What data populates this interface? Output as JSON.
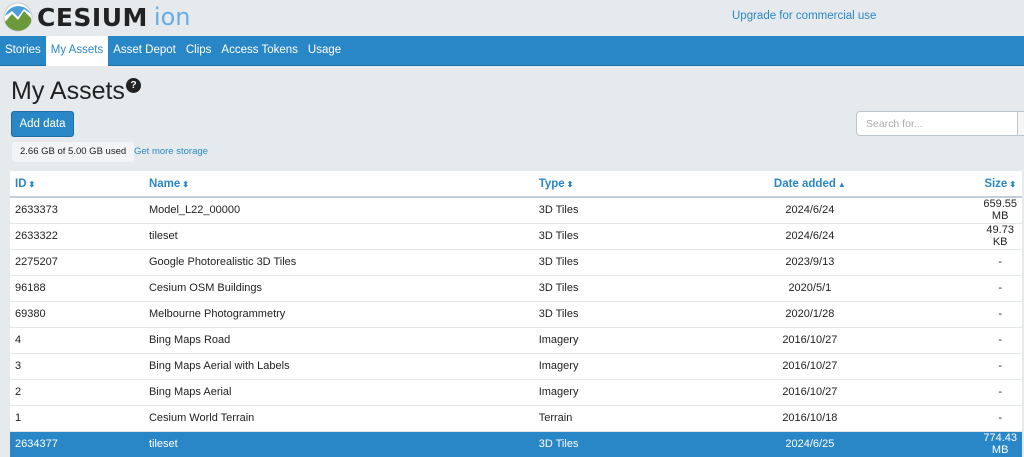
{
  "header": {
    "logo_text": "CESIUM",
    "logo_suffix": "ion",
    "upgrade_link": "Upgrade for commercial use"
  },
  "nav": [
    {
      "label": "Stories"
    },
    {
      "label": "My Assets",
      "active": true
    },
    {
      "label": "Asset Depot"
    },
    {
      "label": "Clips"
    },
    {
      "label": "Access Tokens"
    },
    {
      "label": "Usage"
    }
  ],
  "page": {
    "title": "My Assets",
    "help_icon": "?",
    "add_button": "Add data",
    "storage": "2.66 GB of 5.00 GB used",
    "more_storage": "Get more storage",
    "search_placeholder": "Search for..."
  },
  "table": {
    "columns": [
      {
        "label": "ID",
        "sort": "⬍"
      },
      {
        "label": "Name",
        "sort": "⬍"
      },
      {
        "label": "Type",
        "sort": "⬍"
      },
      {
        "label": "Date added",
        "sort": "▲"
      },
      {
        "label": "Size",
        "sort": "⬍"
      }
    ],
    "rows": [
      [
        "2633373",
        "Model_L22_00000",
        "3D Tiles",
        "2024/6/24",
        "659.55 MB"
      ],
      [
        "2633322",
        "tileset",
        "3D Tiles",
        "2024/6/24",
        "49.73 KB"
      ],
      [
        "2275207",
        "Google Photorealistic 3D Tiles",
        "3D Tiles",
        "2023/9/13",
        "-"
      ],
      [
        "96188",
        "Cesium OSM Buildings",
        "3D Tiles",
        "2020/5/1",
        "-"
      ],
      [
        "69380",
        "Melbourne Photogrammetry",
        "3D Tiles",
        "2020/1/28",
        "-"
      ],
      [
        "4",
        "Bing Maps Road",
        "Imagery",
        "2016/10/27",
        "-"
      ],
      [
        "3",
        "Bing Maps Aerial with Labels",
        "Imagery",
        "2016/10/27",
        "-"
      ],
      [
        "2",
        "Bing Maps Aerial",
        "Imagery",
        "2016/10/27",
        "-"
      ],
      [
        "1",
        "Cesium World Terrain",
        "Terrain",
        "2016/10/18",
        "-"
      ],
      [
        "2634377",
        "tileset",
        "3D Tiles",
        "2024/6/25",
        "774.43 MB"
      ]
    ],
    "selected_row": 9
  },
  "colors": {
    "accent": "#2a87c7",
    "background": "#e6eaed"
  }
}
